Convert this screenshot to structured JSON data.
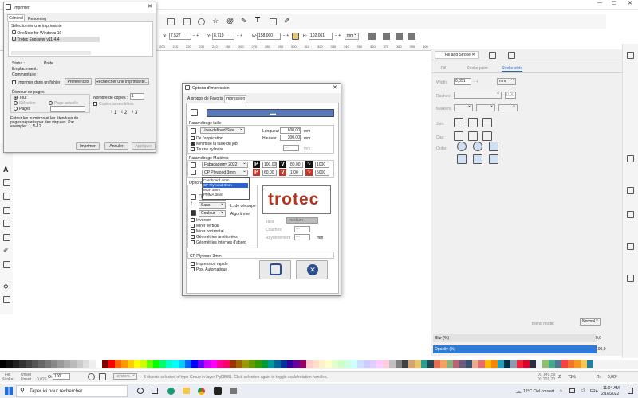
{
  "inkscape": {
    "toolbar": {
      "x_label": "X:",
      "x_value": "7,527",
      "y_label": "Y:",
      "y_value": "8,719",
      "w_label": "W:",
      "w_value": "158,000",
      "h_label": "H:",
      "h_value": "102,061",
      "unit": "mm"
    },
    "ruler_numbers": [
      "200",
      "210",
      "220",
      "230",
      "240",
      "250",
      "260",
      "270",
      "280",
      "290",
      "300",
      "310",
      "320",
      "330",
      "340",
      "350",
      "360",
      "370",
      "380",
      "390",
      "400"
    ],
    "fill_stroke_panel": {
      "tabs": [
        "Fill and Stroke",
        "",
        ""
      ],
      "subtabs": [
        "Fill",
        "Stroke paint",
        "Stroke style"
      ],
      "width_label": "Width:",
      "width_value": "0,051",
      "width_unit": "mm",
      "dashes_label": "Dashes:",
      "dashes_value": "0,00",
      "markers_label": "Markers:",
      "join_label": "Join:",
      "cap_label": "Cap:",
      "order_label": "Order:",
      "blend_label": "Blend mode:",
      "blend_value": "Normal",
      "blur_label": "Blur (%)",
      "blur_value": "0,0",
      "opacity_label": "Opacity (%)",
      "opacity_value": "100,0"
    },
    "statusbar": {
      "fill_label": "Fill:",
      "fill_value": "Unset",
      "stroke_label": "Stroke:",
      "stroke_value": "Unset",
      "stroke_width": "0,026",
      "opacity_label": "O:",
      "opacity_value": "100",
      "layer": "-sýstem-",
      "message": "3 objects selected of type Group in layer Pg08981. Click selection again to toggle scale/rotation handles.",
      "cursor_x": "X: 149,59",
      "cursor_y": "Y: 201,70",
      "zoom_label": "Z:",
      "zoom_value": "71%",
      "rotate_label": "R:",
      "rotate_value": "0,00°"
    }
  },
  "print_dialog": {
    "title": "Imprimer",
    "tabs": [
      "Général",
      "Rendering"
    ],
    "select_printer": "Sélectionner une imprimante",
    "printers": [
      "OneNote for Windows 10",
      "Trotec Engraver v11.4.4"
    ],
    "status_label": "Statut :",
    "status_value": "Prête",
    "location_label": "Emplacement :",
    "comment_label": "Commentaire :",
    "print_to_file": "Imprimer dans un fichier",
    "preferences": "Préférences",
    "find_printer": "Rechercher une imprimante...",
    "page_range": "Étendue de pages",
    "all": "Tout",
    "selection": "Sélection",
    "current_page": "Page actuelle",
    "pages": "Pages",
    "copies_label": "Nombre de copies :",
    "copies_value": "1",
    "collate": "Copies assemblées",
    "hint": "Entrez les numéros et les étendues de pages séparés par des virgules. Par exemple : 1, 5-12",
    "print_btn": "Imprimer",
    "cancel_btn": "Annuler",
    "apply_btn": "Appliquer"
  },
  "options_dialog": {
    "title": "Options d'impression",
    "tabs": [
      "A propos de",
      "Favoris",
      "Impression"
    ],
    "size_group": "Paramétrage taille",
    "size_select": "User-defined Size",
    "length_label": "Longueur",
    "length_value": "600,00",
    "height_label": "Hauteur",
    "height_value": "300,00",
    "mm": "mm",
    "app_opt": "De l'application",
    "min_job": "Minimise la taille du job",
    "rotary": "Tourne cylindre",
    "materials_group": "Paramétrage Matières",
    "material_db": "Fabacademy 2022",
    "material_value": "CP Plywood 3mm",
    "material_options": [
      "Cardboard 4mm",
      "CP Plywood 3mm",
      "MDF 3mm",
      "PMMA 3mm"
    ],
    "p_val1": "100,00",
    "v_val1": "80,00",
    "f_val1": "1000",
    "p_val2": "60,00",
    "v_val2": "1,00",
    "f_val2": "5000",
    "options_group": "Options",
    "resolution_label": "Résolution",
    "resolution_value": "600dpi",
    "cutline_label": "L. de découpe",
    "cutline_value": "Sans",
    "algorithm_label": "Algorithme",
    "algorithm_value": "Couleur",
    "invert": "Inverser",
    "mirror_v": "Mirer vertical",
    "mirror_h": "Mirer horizontal",
    "enhanced_geo": "Géométries améliorées",
    "inner_geo": "Géométries internes d'abord",
    "logo_text": "trotec",
    "size_lbl": "Taille",
    "size_val": "medium",
    "layers_lbl": "Couches",
    "layers_val": "---",
    "distance_lbl": "Rayonnement",
    "distance_val": "---",
    "distance_unit": "mm",
    "material_summary": "CP Plywood 3mm",
    "quick_print": "Impression rapide",
    "auto_pos": "Pos. Automatique"
  },
  "taskbar": {
    "search_placeholder": "Taper ici pour rechercher",
    "weather": "12°C Ciel couvert",
    "lang": "FRA",
    "time": "11:04 AM",
    "date": "2/16/2022"
  }
}
